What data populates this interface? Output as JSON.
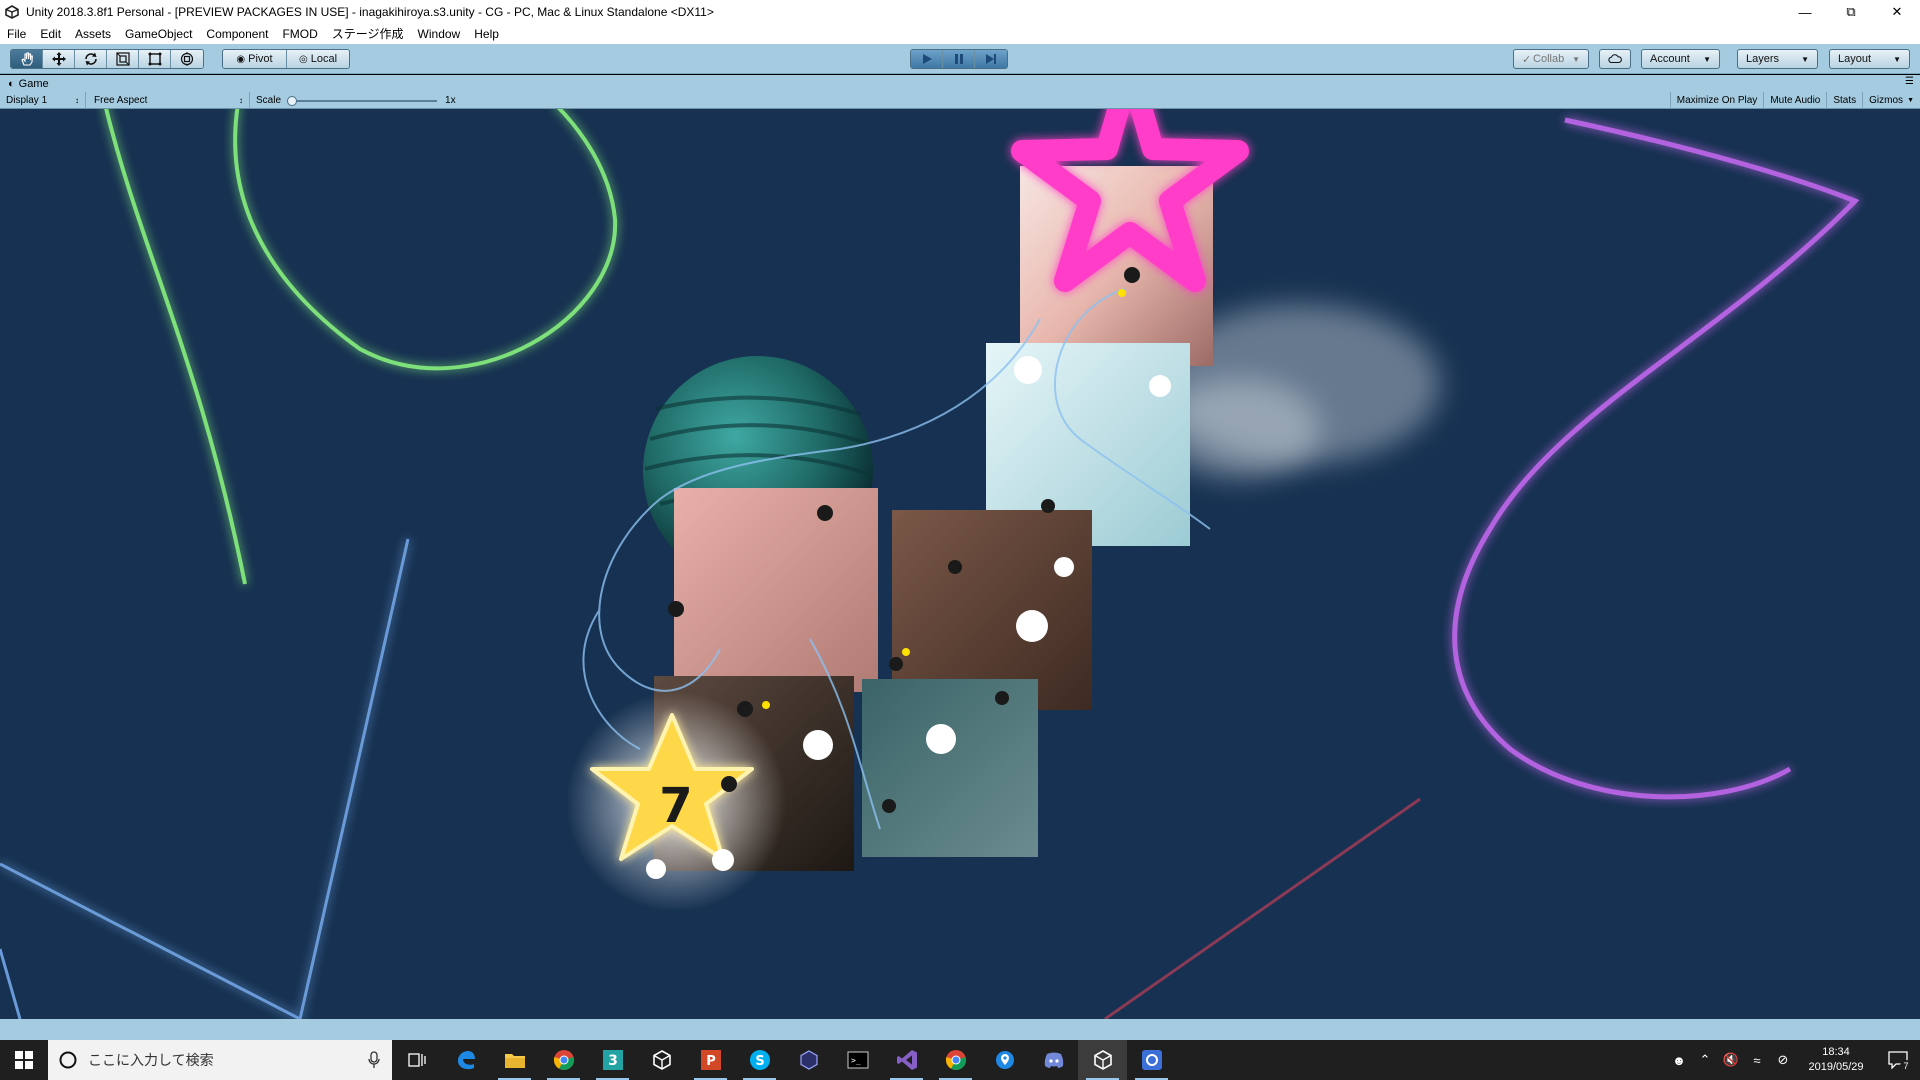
{
  "window": {
    "title": "Unity 2018.3.8f1 Personal - [PREVIEW PACKAGES IN USE] - inagakihiroya.s3.unity - CG - PC, Mac & Linux Standalone <DX11>",
    "minimize": "—",
    "restore": "⧉",
    "close": "✕"
  },
  "menu": [
    "File",
    "Edit",
    "Assets",
    "GameObject",
    "Component",
    "FMOD",
    "ステージ作成",
    "Window",
    "Help"
  ],
  "toolbar": {
    "pivot_label": "Pivot",
    "local_label": "Local",
    "collab_label": "Collab",
    "account_label": "Account",
    "layers_label": "Layers",
    "layout_label": "Layout"
  },
  "game_panel": {
    "tab_label": "Game",
    "display_label": "Display 1",
    "aspect_label": "Free Aspect",
    "scale_label": "Scale",
    "scale_value": "1x",
    "maximize_label": "Maximize On Play",
    "mute_label": "Mute Audio",
    "stats_label": "Stats",
    "gizmos_label": "Gizmos"
  },
  "scene": {
    "star_number": "7",
    "colors": {
      "background": "#163151",
      "green_line": "#7ee07a",
      "blue_line": "#6a9bd8",
      "purple_line": "#b463e0",
      "pink_star": "#ff3dc8",
      "yellow_star": "#ffd84a"
    }
  },
  "taskbar": {
    "search_placeholder": "ここに入力して検索",
    "time": "18:34",
    "date": "2019/05/29",
    "notification_count": "7"
  }
}
